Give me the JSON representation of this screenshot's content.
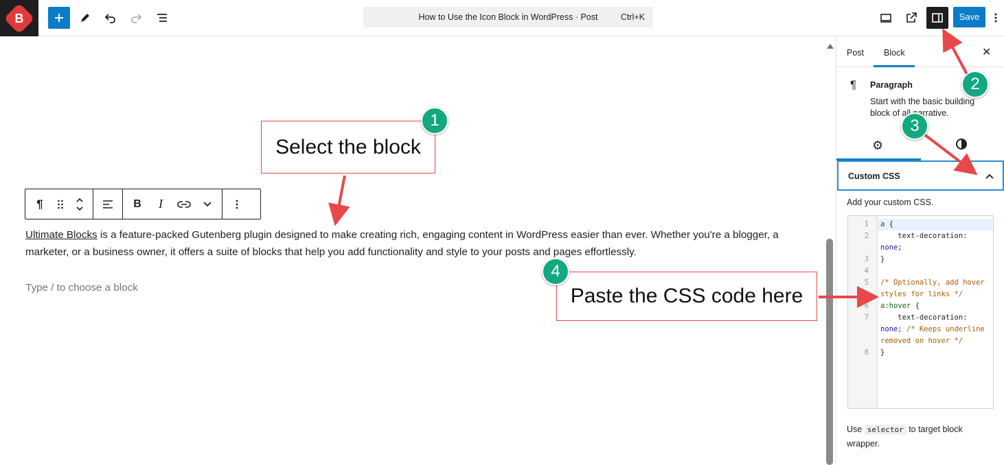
{
  "topbar": {
    "logo_letter": "B",
    "document_title": "How to Use the Icon Block in WordPress · Post",
    "shortcut": "Ctrl+K",
    "save_label": "Save"
  },
  "editor": {
    "paragraph_link": "Ultimate Blocks",
    "paragraph_text": " is a feature-packed Gutenberg plugin designed to make creating rich, engaging content in WordPress easier than ever. Whether you're a blogger, a marketer, or a business owner, it offers a suite of blocks that help you add functionality and style to your posts and pages effortlessly.",
    "placeholder": "Type / to choose a block"
  },
  "annotations": [
    {
      "number": "1",
      "text": "Select the block"
    },
    {
      "number": "2"
    },
    {
      "number": "3"
    },
    {
      "number": "4",
      "text": "Paste the CSS code here"
    }
  ],
  "sidebar": {
    "tab_post": "Post",
    "tab_block": "Block",
    "block_name": "Paragraph",
    "block_desc": "Start with the basic building block of all narrative.",
    "panel_title": "Custom CSS",
    "panel_help": "Add your custom CSS.",
    "code_lines": [
      "1",
      "2",
      "",
      "3",
      "4",
      "5",
      "",
      "6",
      "7",
      "",
      "",
      "8"
    ],
    "footer_use": "Use",
    "footer_chip": "selector",
    "footer_rest": "to target block wrapper."
  }
}
